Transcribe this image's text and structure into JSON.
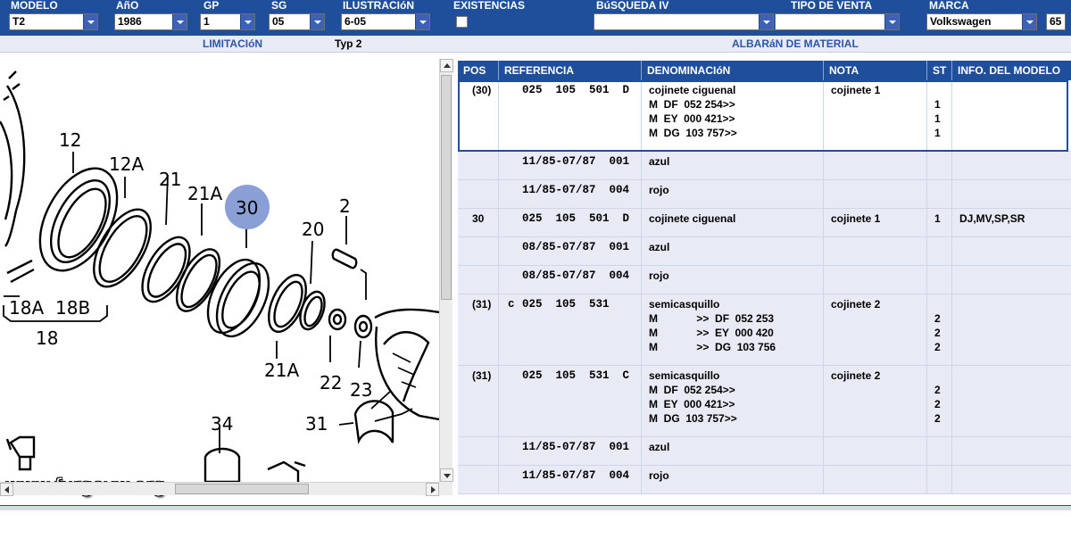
{
  "filters": {
    "modelo": {
      "label": "MODELO",
      "value": "T2"
    },
    "anio": {
      "label": "AñO",
      "value": "1986"
    },
    "gp": {
      "label": "GP",
      "value": "1"
    },
    "sg": {
      "label": "SG",
      "value": "05"
    },
    "ilustracion": {
      "label": "ILUSTRACIóN",
      "value": "6-05"
    },
    "existencias": {
      "label": "EXISTENCIAS",
      "checked": false
    },
    "busqueda": {
      "label": "BúSQUEDA IV",
      "value": ""
    },
    "tipo_venta": {
      "label": "TIPO DE VENTA",
      "value": ""
    },
    "marca": {
      "label": "MARCA",
      "value": "Volkswagen",
      "extra": "65"
    }
  },
  "strip": {
    "limitacion_label": "LIMITACIóN",
    "limitacion_value": "Typ 2",
    "albaran_label": "ALBARáN DE MATERIAL"
  },
  "illustration": {
    "watermark": "www.furgovw.org",
    "callouts": [
      "12",
      "12A",
      "21",
      "21A",
      "30",
      "2",
      "20",
      "18A",
      "18B",
      "18",
      "21A",
      "22",
      "23",
      "34",
      "31"
    ]
  },
  "table": {
    "headers": [
      "POS",
      "REFERENCIA",
      "DENOMINACIóN",
      "NOTA",
      "ST",
      "INFO. DEL MODELO"
    ],
    "rows": [
      {
        "pos": "(30)",
        "flag": "",
        "ref": "025  105  501  D",
        "den": [
          "cojinete ciguenal",
          "M  DF  052 254>>",
          "M  EY  000 421>>",
          "M  DG  103 757>>"
        ],
        "nota": "cojinete 1",
        "st": [
          "",
          "1",
          "1",
          "1"
        ],
        "info": ""
      },
      {
        "pos": "",
        "flag": "",
        "ref": "11/85-07/87  001",
        "den": [
          "azul"
        ],
        "nota": "",
        "st": [
          ""
        ],
        "info": ""
      },
      {
        "pos": "",
        "flag": "",
        "ref": "11/85-07/87  004",
        "den": [
          "rojo"
        ],
        "nota": "",
        "st": [
          ""
        ],
        "info": ""
      },
      {
        "pos": "30",
        "flag": "",
        "ref": "025  105  501  D",
        "den": [
          "cojinete ciguenal"
        ],
        "nota": "cojinete 1",
        "st": [
          "1"
        ],
        "info": "DJ,MV,SP,SR"
      },
      {
        "pos": "",
        "flag": "",
        "ref": "08/85-07/87  001",
        "den": [
          "azul"
        ],
        "nota": "",
        "st": [
          ""
        ],
        "info": ""
      },
      {
        "pos": "",
        "flag": "",
        "ref": "08/85-07/87  004",
        "den": [
          "rojo"
        ],
        "nota": "",
        "st": [
          ""
        ],
        "info": ""
      },
      {
        "pos": "(31)",
        "flag": "c",
        "ref": "025  105  531",
        "den": [
          "semicasquillo",
          "M             >>  DF  052 253",
          "M             >>  EY  000 420",
          "M             >>  DG  103 756"
        ],
        "nota": "cojinete 2",
        "st": [
          "",
          "2",
          "2",
          "2"
        ],
        "info": ""
      },
      {
        "pos": "(31)",
        "flag": "",
        "ref": "025  105  531  C",
        "den": [
          "semicasquillo",
          "M  DF  052 254>>",
          "M  EY  000 421>>",
          "M  DG  103 757>>"
        ],
        "nota": "cojinete 2",
        "st": [
          "",
          "2",
          "2",
          "2"
        ],
        "info": ""
      },
      {
        "pos": "",
        "flag": "",
        "ref": "11/85-07/87  001",
        "den": [
          "azul"
        ],
        "nota": "",
        "st": [
          ""
        ],
        "info": ""
      },
      {
        "pos": "",
        "flag": "",
        "ref": "11/85-07/87  004",
        "den": [
          "rojo"
        ],
        "nota": "",
        "st": [
          ""
        ],
        "info": ""
      }
    ]
  },
  "colors": {
    "header_blue": "#1f4f9a",
    "row_shade": "#e8eaf5",
    "callout_highlight": "#8a9fd6"
  }
}
